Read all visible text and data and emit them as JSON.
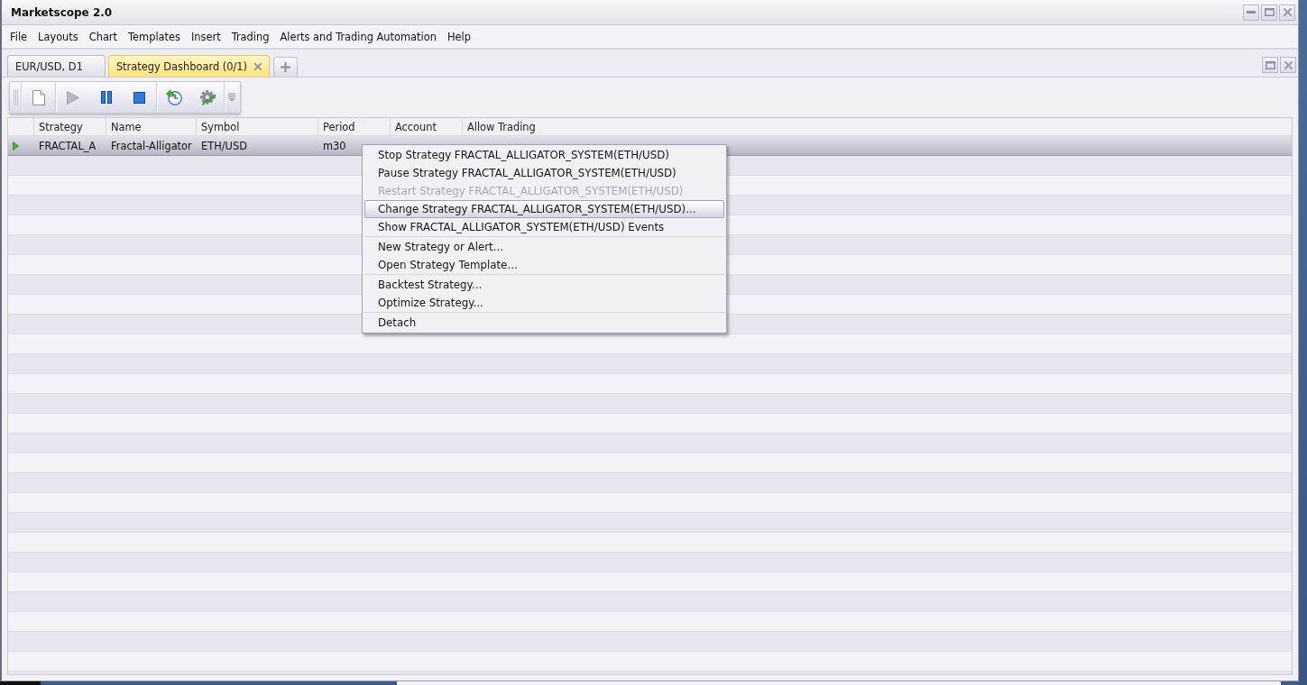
{
  "window": {
    "title": "Marketscope 2.0"
  },
  "menu_bar": [
    "File",
    "Layouts",
    "Chart",
    "Templates",
    "Insert",
    "Trading",
    "Alerts and Trading Automation",
    "Help"
  ],
  "tabs": [
    {
      "label": "EUR/USD, D1",
      "selected": false
    },
    {
      "label": "Strategy Dashboard (0/1)",
      "selected": true
    }
  ],
  "toolbar": [
    {
      "disabled": false
    },
    {
      "disabled": true
    },
    {
      "disabled": false
    },
    {
      "disabled": false
    },
    {
      "disabled": false
    },
    {
      "disabled": false
    }
  ],
  "table": {
    "columns": [
      "Strategy",
      "Name",
      "Symbol",
      "Period",
      "Account",
      "Allow Trading"
    ],
    "rows": [
      {
        "selected": true,
        "cells": [
          "FRACTAL_A",
          "Fractal-Alligator",
          "ETH/USD",
          "m30"
        ]
      }
    ]
  },
  "context_menu": {
    "sections": [
      {
        "items": [
          {
            "label": "Stop Strategy FRACTAL_ALLIGATOR_SYSTEM(ETH/USD)",
            "disabled": false,
            "selected": false
          },
          {
            "label": "Pause Strategy FRACTAL_ALLIGATOR_SYSTEM(ETH/USD)",
            "disabled": false,
            "selected": false
          },
          {
            "label": "Restart Strategy FRACTAL_ALLIGATOR_SYSTEM(ETH/USD)",
            "disabled": true,
            "selected": false
          },
          {
            "label": "Change Strategy FRACTAL_ALLIGATOR_SYSTEM(ETH/USD)...",
            "disabled": false,
            "selected": true
          },
          {
            "label": "Show FRACTAL_ALLIGATOR_SYSTEM(ETH/USD) Events",
            "disabled": false,
            "selected": false
          }
        ]
      },
      {
        "items": [
          {
            "label": "New Strategy or Alert...",
            "disabled": false,
            "selected": false
          },
          {
            "label": "Open Strategy Template...",
            "disabled": false,
            "selected": false
          }
        ]
      },
      {
        "items": [
          {
            "label": "Backtest Strategy...",
            "disabled": false,
            "selected": false
          },
          {
            "label": "Optimize Strategy...",
            "disabled": false,
            "selected": false
          }
        ]
      },
      {
        "items": [
          {
            "label": "Detach",
            "disabled": false,
            "selected": false
          }
        ]
      }
    ]
  }
}
